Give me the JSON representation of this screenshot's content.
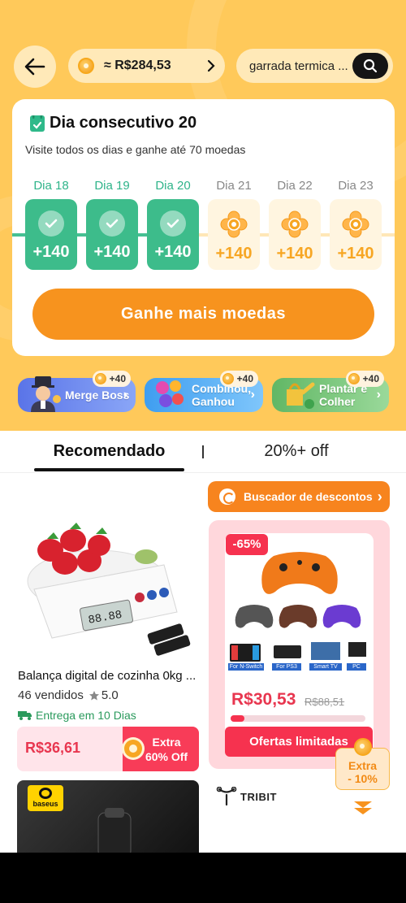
{
  "header": {
    "back_icon": "arrow-left-icon",
    "balance": "≈ R$284,53",
    "search_query": "garrada termica ...",
    "search_icon": "search-icon"
  },
  "checkin": {
    "title": "Dia consecutivo 20",
    "subtitle": "Visite todos os dias e ganhe até 70 moedas",
    "days": [
      {
        "label": "Dia 18",
        "reward": "+140",
        "done": true
      },
      {
        "label": "Dia 19",
        "reward": "+140",
        "done": true
      },
      {
        "label": "Dia 20",
        "reward": "+140",
        "done": true
      },
      {
        "label": "Dia 21",
        "reward": "+140",
        "done": false
      },
      {
        "label": "Dia 22",
        "reward": "+140",
        "done": false
      },
      {
        "label": "Dia 23",
        "reward": "+140",
        "done": false
      }
    ],
    "cta": "Ganhe mais moedas"
  },
  "games": [
    {
      "label": "Merge Boss",
      "badge": "+40",
      "color": "#6f8af0"
    },
    {
      "label": "Combinou, Ganhou",
      "badge": "+40",
      "color": "#4fa8f2"
    },
    {
      "label": "Plantar e Colher",
      "badge": "+40",
      "color": "#77c47a"
    }
  ],
  "tabs": {
    "active": "Recomendado",
    "other": "20%+ off"
  },
  "finder": {
    "label": "Buscador de descontos"
  },
  "product_left": {
    "title": "Balança digital de cozinha 0kg ...",
    "sold": "46 vendidos",
    "rating": "5.0",
    "shipping": "Entrega em 10 Dias",
    "price": "R$36,61",
    "extra": "Extra",
    "extra_pct": "60% Off"
  },
  "product_right": {
    "discount": "-65%",
    "console_labels": [
      "For N-Switch",
      "For PS3",
      "Smart TV",
      "PC"
    ],
    "price": "R$30,53",
    "old_price": "R$88,51",
    "progress": 0.1,
    "cta": "Ofertas limitadas"
  },
  "extra_float": {
    "line1": "Extra",
    "line2": "- 10%"
  },
  "brands": {
    "baseus": "baseus",
    "tribit": "TRIBIT"
  },
  "colors": {
    "accent_orange": "#f7931e",
    "check_green": "#3dbc8b",
    "sale_red": "#f6324f",
    "page_yellow": "#ffc95a"
  }
}
